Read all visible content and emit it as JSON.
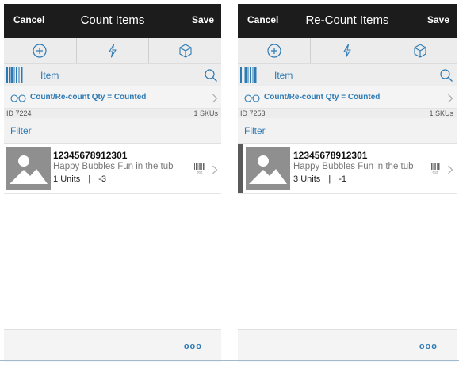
{
  "colors": {
    "accent": "#2d7ab3",
    "topbar": "#1c1c1c"
  },
  "screens": [
    {
      "cancel_label": "Cancel",
      "title": "Count Items",
      "save_label": "Save",
      "actions": [
        "plus-circle-icon",
        "lightning-icon",
        "box-icon"
      ],
      "search_label": "Item",
      "filter_rule": "Count/Re-count Qty = Counted",
      "id_text": "ID 7224",
      "skus_text": "1 SKUs",
      "filter_label": "Filter",
      "item": {
        "sku": "12345678912301",
        "description": "Happy Bubbles Fun in the tub",
        "qty": "1",
        "unit": "Units",
        "sep": "|",
        "variance": "-3",
        "barcode_text": "012"
      },
      "more_label": "ooo"
    },
    {
      "cancel_label": "Cancel",
      "title": "Re-Count Items",
      "save_label": "Save",
      "actions": [
        "plus-circle-icon",
        "lightning-icon",
        "box-icon"
      ],
      "search_label": "Item",
      "filter_rule": "Count/Re-count Qty = Counted",
      "id_text": "ID 7253",
      "skus_text": "1 SKUs",
      "filter_label": "Filter",
      "item": {
        "sku": "12345678912301",
        "description": "Happy Bubbles Fun in the tub",
        "qty": "3",
        "unit": "Units",
        "sep": "|",
        "variance": "-1",
        "barcode_text": "012"
      },
      "more_label": "ooo"
    }
  ]
}
